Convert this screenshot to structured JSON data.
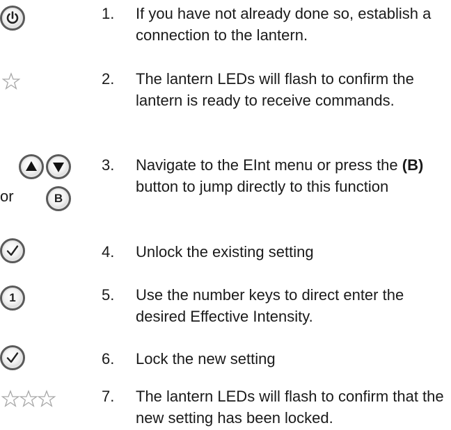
{
  "or_label": "or",
  "b_key": "B",
  "one_key": "1",
  "steps": [
    {
      "num": "1.",
      "text": "If you have not already done so, establish a connection to the lantern.",
      "icon": "power-icon"
    },
    {
      "num": "2.",
      "text": "The lantern LEDs will flash to confirm the lantern is ready to receive commands.",
      "icon": "star-icon"
    },
    {
      "num": "3.",
      "pre": "Navigate to the EInt menu or press the ",
      "bold": "(B)",
      "post": " button to jump directly to this function",
      "icon": "up-down-b-keys"
    },
    {
      "num": "4.",
      "text": "Unlock the existing setting",
      "icon": "check-icon"
    },
    {
      "num": "5.",
      "text": "Use the number keys to direct enter the desired Effective Intensity.",
      "icon": "number-key-icon"
    },
    {
      "num": "6.",
      "text": "Lock the new setting",
      "icon": "check-icon"
    },
    {
      "num": "7.",
      "text": "The lantern LEDs will flash to confirm that the new setting has been locked.",
      "icon": "three-stars-icon"
    }
  ],
  "colors": {
    "text": "#1a1a1a",
    "button_rim": "#5a5a5a",
    "star_outline": "#a8a8a8"
  }
}
